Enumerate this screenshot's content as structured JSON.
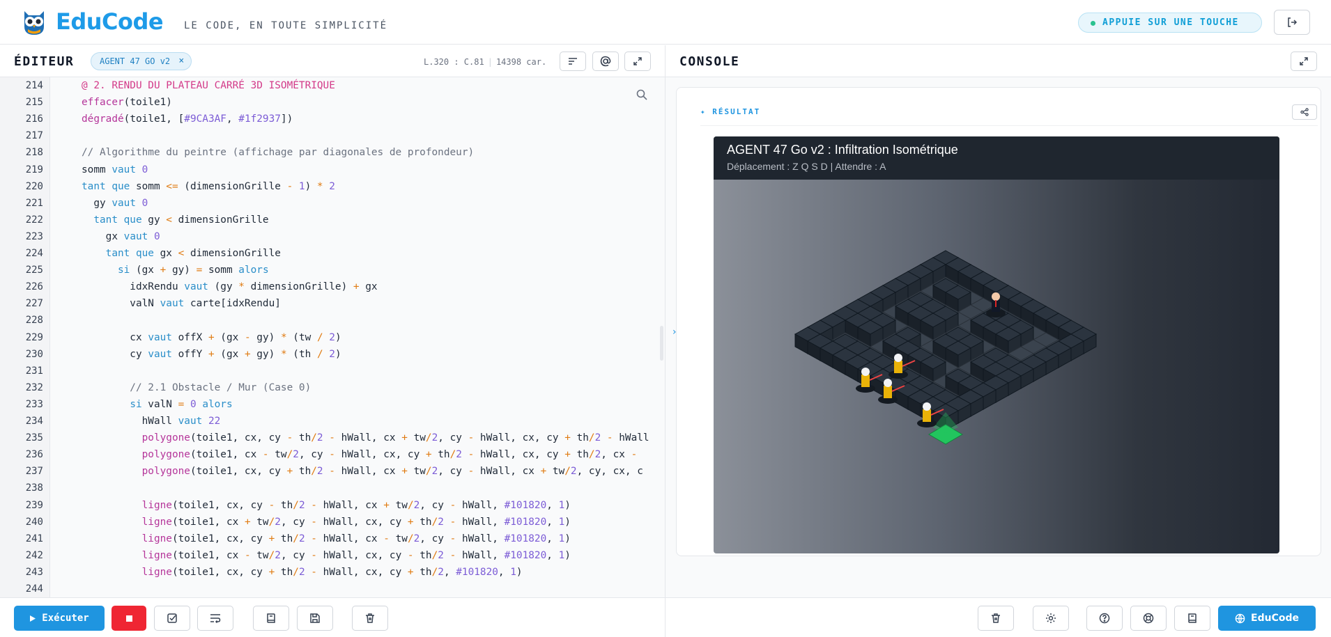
{
  "header": {
    "logo_text": "EduCode",
    "tagline": "LE CODE, EN TOUTE SIMPLICITÉ",
    "key_status": "APPUIE SUR UNE TOUCHE",
    "status_color": "#29c28f",
    "brand_color": "#1e9be8"
  },
  "editor": {
    "title": "ÉDITEUR",
    "file_name": "AGENT 47 GO v2",
    "close_glyph": "×",
    "cursor_pos": "L.320 : C.81",
    "char_count": "14398 car.",
    "run_label": "Exécuter",
    "lines": [
      {
        "n": "214"
      },
      {
        "n": "215"
      },
      {
        "n": "216"
      },
      {
        "n": "217"
      },
      {
        "n": "218"
      },
      {
        "n": "219"
      },
      {
        "n": "220"
      },
      {
        "n": "221"
      },
      {
        "n": "222"
      },
      {
        "n": "223"
      },
      {
        "n": "224"
      },
      {
        "n": "225"
      },
      {
        "n": "226"
      },
      {
        "n": "227"
      },
      {
        "n": "228"
      },
      {
        "n": "229"
      },
      {
        "n": "230"
      },
      {
        "n": "231"
      },
      {
        "n": "232"
      },
      {
        "n": "233"
      },
      {
        "n": "234"
      },
      {
        "n": "235"
      },
      {
        "n": "236"
      },
      {
        "n": "237"
      },
      {
        "n": "238"
      },
      {
        "n": "239"
      },
      {
        "n": "240"
      },
      {
        "n": "241"
      },
      {
        "n": "242"
      },
      {
        "n": "243"
      },
      {
        "n": "244"
      }
    ],
    "code": [
      "@ 2. RENDU DU PLATEAU CARRÉ 3D ISOMÉTRIQUE",
      "effacer(toile1)",
      "dégradé(toile1, [#9CA3AF, #1f2937])",
      "",
      "// Algorithme du peintre (affichage par diagonales de profondeur)",
      "somm vaut 0",
      "tant que somm <= (dimensionGrille - 1) * 2",
      "  gy vaut 0",
      "  tant que gy < dimensionGrille",
      "    gx vaut 0",
      "    tant que gx < dimensionGrille",
      "      si (gx + gy) = somm alors",
      "        idxRendu vaut (gy * dimensionGrille) + gx",
      "        valN vaut carte[idxRendu]",
      "",
      "        cx vaut offX + (gx - gy) * (tw / 2)",
      "        cy vaut offY + (gx + gy) * (th / 2)",
      "",
      "        // 2.1 Obstacle / Mur (Case 0)",
      "        si valN = 0 alors",
      "          hWall vaut 22",
      "          polygone(toile1, cx, cy - th/2 - hWall, cx + tw/2, cy - hWall, cx, cy + th/2 - hWall",
      "          polygone(toile1, cx - tw/2, cy - hWall, cx, cy + th/2 - hWall, cx, cy + th/2, cx -",
      "          polygone(toile1, cx, cy + th/2 - hWall, cx + tw/2, cy - hWall, cx + tw/2, cy, cx, c",
      "",
      "          ligne(toile1, cx, cy - th/2 - hWall, cx + tw/2, cy - hWall, #101820, 1)",
      "          ligne(toile1, cx + tw/2, cy - hWall, cx, cy + th/2 - hWall, #101820, 1)",
      "          ligne(toile1, cx, cy + th/2 - hWall, cx - tw/2, cy - hWall, #101820, 1)",
      "          ligne(toile1, cx - tw/2, cy - hWall, cx, cy - th/2 - hWall, #101820, 1)",
      "          ligne(toile1, cx, cy + th/2 - hWall, cx, cy + th/2, #101820, 1)",
      ""
    ]
  },
  "console": {
    "title": "CONSOLE",
    "result_label": "✦ RÉSULTAT",
    "chevron": "›",
    "game_title": "AGENT 47 Go v2 : Infiltration Isométrique",
    "game_subtitle": "Déplacement : Z Q S D | Attendre : A",
    "educode_label": "EduCode"
  }
}
